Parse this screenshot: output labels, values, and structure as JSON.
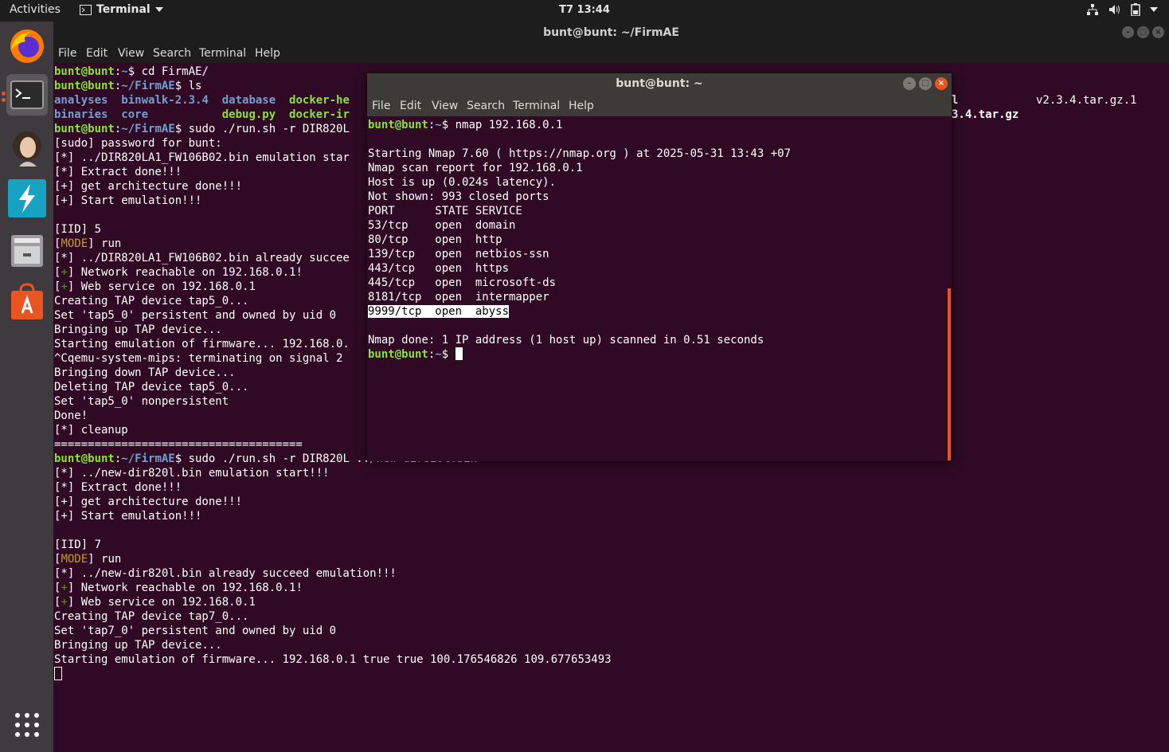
{
  "topbar": {
    "activities": "Activities",
    "app_name": "Terminal",
    "clock": "T7 13:44"
  },
  "main_window": {
    "title": "bunt@bunt: ~/FirmAE",
    "menu": [
      "File",
      "Edit",
      "View",
      "Search",
      "Terminal",
      "Help"
    ],
    "bg_color": "#300a24",
    "lines_right": {
      "line3_tail": "l",
      "line3_file": "v2.3.4.tar.gz.1",
      "line4_tail": "3.4.tar.gz"
    }
  },
  "second_window": {
    "title": "bunt@bunt: ~",
    "menu": [
      "File",
      "Edit",
      "View",
      "Search",
      "Terminal",
      "Help"
    ]
  },
  "terminal_main": {
    "prompt_user": "bunt@bunt",
    "prompt_home": "~",
    "prompt_firmae": "~/FirmAE",
    "cmd_cd": "cd FirmAE/",
    "cmd_ls": "ls",
    "ls_row1": [
      "analyses",
      "binwalk-2.3.4",
      "database",
      "docker-he"
    ],
    "ls_row2": [
      "binaries",
      "core",
      "debug.py",
      "docker-ir"
    ],
    "cmd_run1": "sudo ./run.sh -r DIR820L",
    "sudo_prompt": "[sudo] password for bunt:",
    "run1_lines": [
      "[*] ../DIR820LA1_FW106B02.bin emulation star",
      "[*] Extract done!!!",
      "[+] get architecture done!!!",
      "[+] Start emulation!!!"
    ],
    "iid1": "[IID] 5",
    "mode_label": "MODE",
    "mode_value": "run",
    "run1_succeed": "[*] ../DIR820LA1_FW106B02.bin already succee",
    "network_reachable": "Network reachable on 192.168.0.1!",
    "web_service": "Web service on 192.168.0.1",
    "run1_after": [
      "Creating TAP device tap5_0...",
      "Set 'tap5_0' persistent and owned by uid 0",
      "Bringing up TAP device...",
      "Starting emulation of firmware... 192.168.0.",
      "^Cqemu-system-mips: terminating on signal 2",
      "Bringing down TAP device...",
      "Deleting TAP device tap5_0...",
      "Set 'tap5_0' nonpersistent",
      "Done!",
      "[*] cleanup",
      "====================================="
    ],
    "cmd_run2": "sudo ./run.sh -r DIR820L ../new-dir820l.bin",
    "run2_lines": [
      "[*] ../new-dir820l.bin emulation start!!!",
      "[*] Extract done!!!",
      "[+] get architecture done!!!",
      "[+] Start emulation!!!"
    ],
    "iid2": "[IID] 7",
    "run2_succeed": "[*] ../new-dir820l.bin already succeed emulation!!!",
    "run2_after": [
      "Creating TAP device tap7_0...",
      "Set 'tap7_0' persistent and owned by uid 0",
      "Bringing up TAP device...",
      "Starting emulation of firmware... 192.168.0.1 true true 100.176546826 109.677653493"
    ]
  },
  "terminal_nmap": {
    "cmd": "nmap 192.168.0.1",
    "header": [
      "Starting Nmap 7.60 ( https://nmap.org ) at 2025-05-31 13:43 +07",
      "Nmap scan report for 192.168.0.1",
      "Host is up (0.024s latency).",
      "Not shown: 993 closed ports"
    ],
    "table_header": "PORT      STATE SERVICE",
    "ports": [
      "53/tcp    open  domain",
      "80/tcp    open  http",
      "139/tcp   open  netbios-ssn",
      "443/tcp   open  https",
      "445/tcp   open  microsoft-ds",
      "8181/tcp  open  intermapper"
    ],
    "highlighted_port": "9999/tcp  open  abyss",
    "done": "Nmap done: 1 IP address (1 host up) scanned in 0.51 seconds"
  },
  "colors": {
    "accent": "#e95420",
    "prompt_green": "#8ae234",
    "dir_blue": "#729fcf",
    "mode_yellow": "#c4a000"
  }
}
